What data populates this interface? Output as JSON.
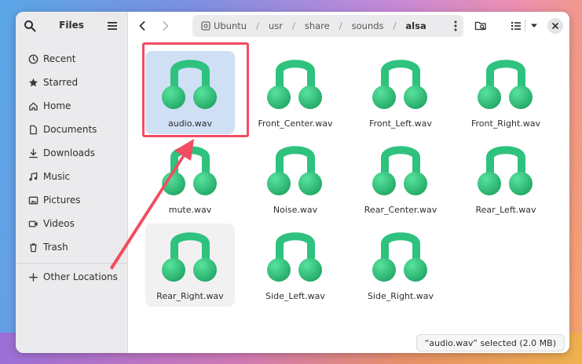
{
  "window": {
    "title": "Files"
  },
  "sidebar": {
    "items": [
      {
        "label": "Recent",
        "icon": "clock-icon"
      },
      {
        "label": "Starred",
        "icon": "star-icon"
      },
      {
        "label": "Home",
        "icon": "home-icon"
      },
      {
        "label": "Documents",
        "icon": "document-icon"
      },
      {
        "label": "Downloads",
        "icon": "download-icon"
      },
      {
        "label": "Music",
        "icon": "music-icon"
      },
      {
        "label": "Pictures",
        "icon": "picture-icon"
      },
      {
        "label": "Videos",
        "icon": "video-icon"
      },
      {
        "label": "Trash",
        "icon": "trash-icon"
      }
    ],
    "other": {
      "label": "Other Locations",
      "icon": "plus-icon"
    }
  },
  "pathbar": {
    "segments": [
      "Ubuntu",
      "usr",
      "share",
      "sounds",
      "alsa"
    ],
    "current": "alsa"
  },
  "files": [
    {
      "name": "audio.wav",
      "state": "selected"
    },
    {
      "name": "Front_Center.wav",
      "state": "normal"
    },
    {
      "name": "Front_Left.wav",
      "state": "normal"
    },
    {
      "name": "Front_Right.wav",
      "state": "normal"
    },
    {
      "name": "mute.wav",
      "state": "normal"
    },
    {
      "name": "Noise.wav",
      "state": "normal"
    },
    {
      "name": "Rear_Center.wav",
      "state": "normal"
    },
    {
      "name": "Rear_Left.wav",
      "state": "normal"
    },
    {
      "name": "Rear_Right.wav",
      "state": "hover"
    },
    {
      "name": "Side_Left.wav",
      "state": "normal"
    },
    {
      "name": "Side_Right.wav",
      "state": "normal"
    }
  ],
  "status": {
    "text": "“audio.wav” selected  (2.0 MB)"
  },
  "colors": {
    "accent": "#2ec27e",
    "selection": "#cfe0f5",
    "annotation": "#f24c62"
  }
}
